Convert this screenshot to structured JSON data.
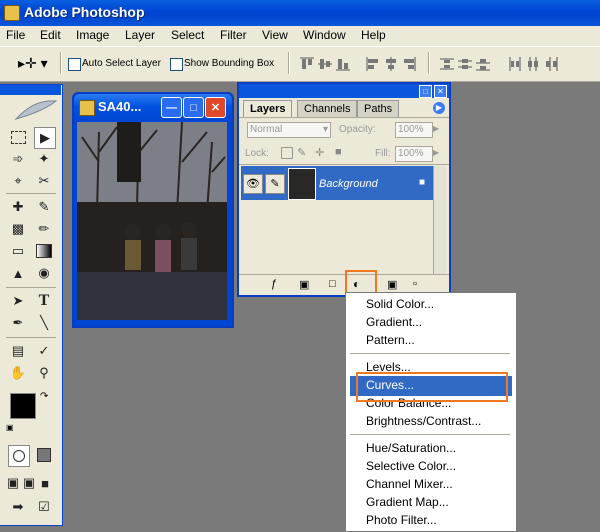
{
  "app": {
    "title": "Adobe Photoshop"
  },
  "menu": [
    "File",
    "Edit",
    "Image",
    "Layer",
    "Select",
    "Filter",
    "View",
    "Window",
    "Help"
  ],
  "options": {
    "auto_select_layer": "Auto Select Layer",
    "show_bounding_box": "Show Bounding Box"
  },
  "image_window": {
    "title": "SA40..."
  },
  "layers_panel": {
    "tabs": [
      "Layers",
      "Channels",
      "Paths"
    ],
    "blend_mode": "Normal",
    "opacity_label": "Opacity:",
    "opacity_value": "100%",
    "lock_label": "Lock:",
    "fill_label": "Fill:",
    "fill_value": "100%",
    "layer_name": "Background"
  },
  "dropdown": {
    "group1": [
      "Solid Color...",
      "Gradient...",
      "Pattern..."
    ],
    "group2": [
      "Levels...",
      "Curves...",
      "Color Balance...",
      "Brightness/Contrast..."
    ],
    "group3": [
      "Hue/Saturation...",
      "Selective Color...",
      "Channel Mixer...",
      "Gradient Map...",
      "Photo Filter..."
    ],
    "highlighted": "Curves..."
  },
  "colors": {
    "titlebar": "#0046d5",
    "highlight": "#316ac5",
    "callout": "#f07820"
  }
}
